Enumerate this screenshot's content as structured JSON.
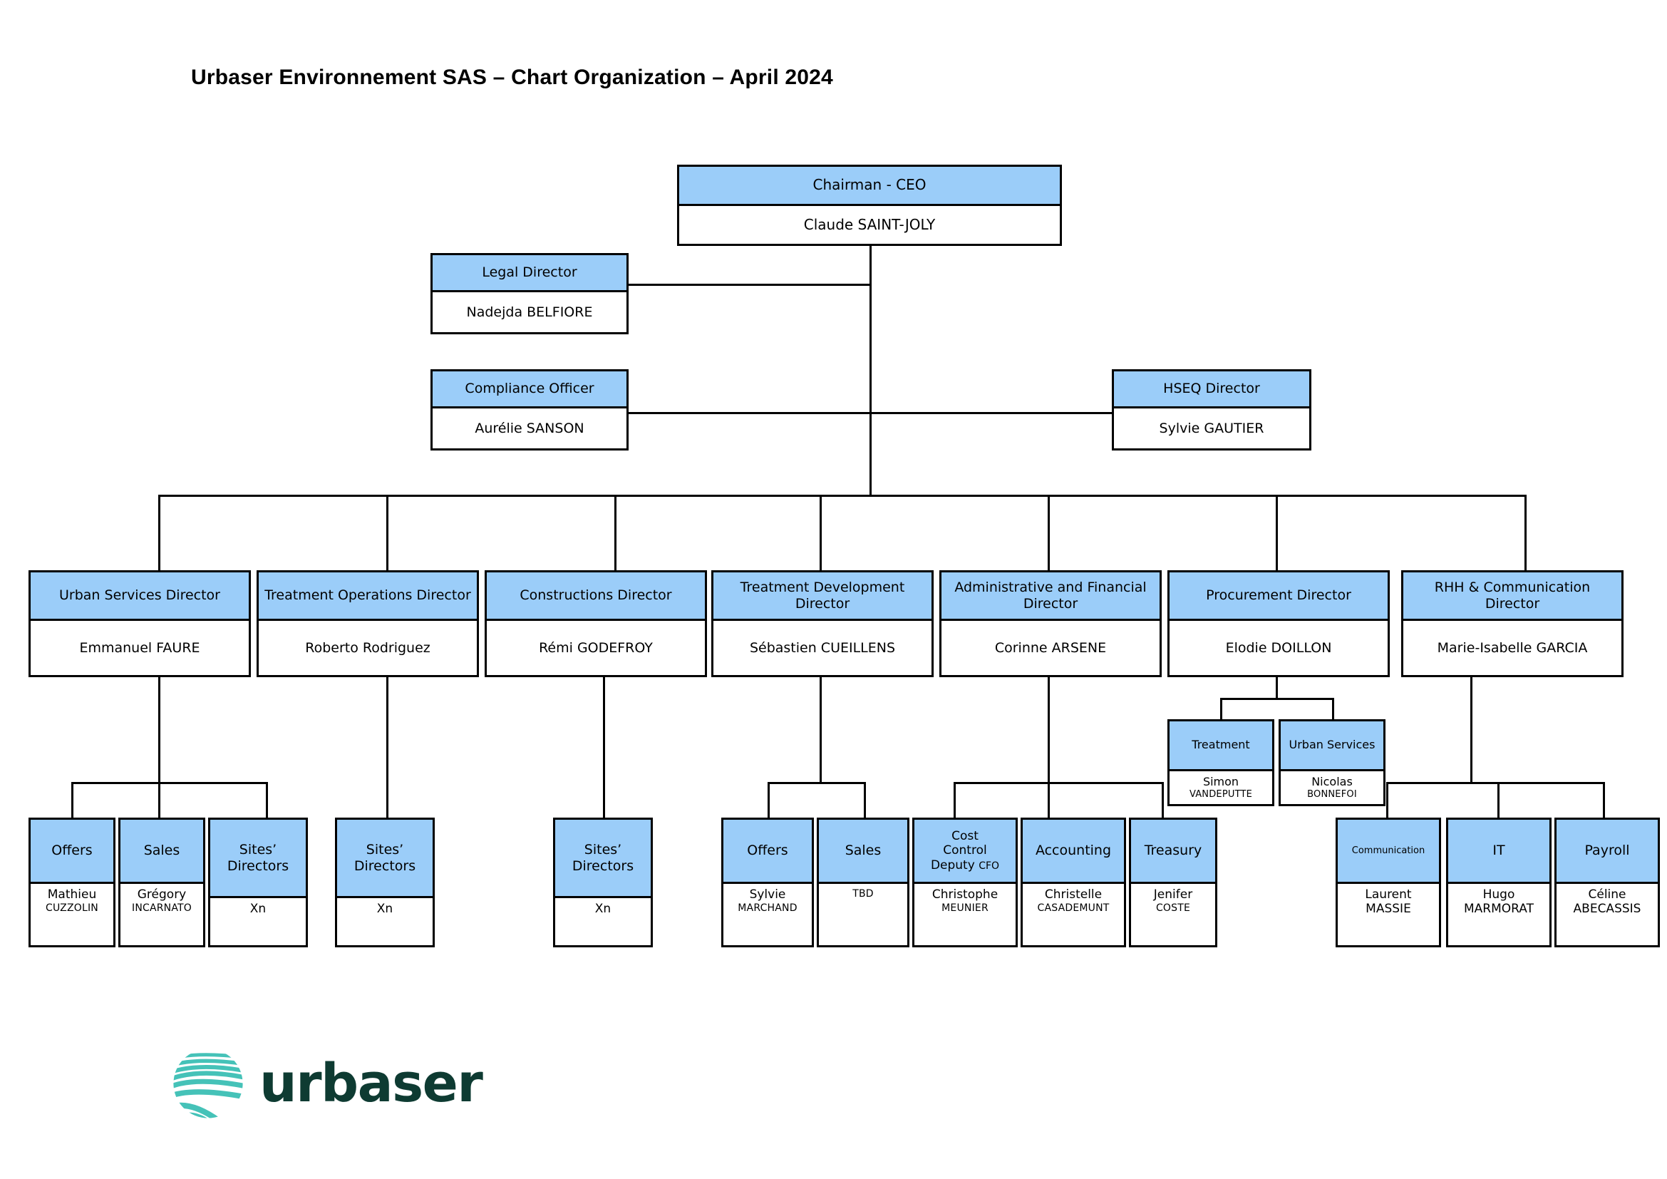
{
  "title": "Urbaser Environnement SAS – Chart Organization – April 2024",
  "logo": {
    "word": "urbaser",
    "globe_color": "#45C2B8",
    "text_color": "#0E3B32"
  },
  "colors": {
    "header_blue": "#9BCDF9",
    "line": "#000000",
    "box_bg": "#FFFFFF"
  },
  "nodes": {
    "ceo": {
      "role": "Chairman - CEO",
      "name": "Claude SAINT-JOLY"
    },
    "legal": {
      "role": "Legal Director",
      "name": "Nadejda BELFIORE"
    },
    "compliance": {
      "role": "Compliance Officer",
      "name": "Aurélie SANSON"
    },
    "hseq": {
      "role": "HSEQ Director",
      "name": "Sylvie GAUTIER"
    },
    "urban": {
      "role": "Urban Services Director",
      "name": "Emmanuel FAURE"
    },
    "treatops": {
      "role": "Treatment Operations Director",
      "name": "Roberto Rodriguez"
    },
    "construct": {
      "role": "Constructions Director",
      "name": "Rémi GODEFROY"
    },
    "treatdev": {
      "role": "Treatment Development Director",
      "name": "Sébastien CUEILLENS"
    },
    "admfin": {
      "role": "Administrative and Financial Director",
      "name": "Corinne ARSENE"
    },
    "procure": {
      "role": "Procurement Director",
      "name": "Elodie DOILLON"
    },
    "rhh": {
      "role": "RHH & Communication Director",
      "name": "Marie-Isabelle GARCIA"
    },
    "proc_treatment": {
      "role": "Treatment",
      "first": "Simon",
      "last": "VANDEPUTTE"
    },
    "proc_urban": {
      "role": "Urban Services",
      "first": "Nicolas",
      "last": "BONNEFOI"
    },
    "urb_offers": {
      "role": "Offers",
      "first": "Mathieu",
      "last": "CUZZOLIN"
    },
    "urb_sales": {
      "role": "Sales",
      "first": "Grégory",
      "last": "INCARNATO"
    },
    "urb_sites": {
      "role_line1": "Sites’",
      "role_line2": "Directors",
      "first": "Xn"
    },
    "treat_sites": {
      "role_line1": "Sites’",
      "role_line2": "Directors",
      "first": "Xn"
    },
    "const_sites": {
      "role_line1": "Sites’",
      "role_line2": "Directors",
      "first": "Xn"
    },
    "td_offers": {
      "role": "Offers",
      "first": "Sylvie",
      "last": "MARCHAND"
    },
    "td_sales": {
      "role": "Sales",
      "first": "TBD"
    },
    "cost_control": {
      "role_line1": "Cost",
      "role_line2": "Control",
      "role_line3": "Deputy",
      "role_sup": "CFO",
      "first": "Christophe",
      "last": "MEUNIER"
    },
    "accounting": {
      "role": "Accounting",
      "first": "Christelle",
      "last": "CASADEMUNT"
    },
    "treasury": {
      "role": "Treasury",
      "first": "Jenifer",
      "last": "COSTE"
    },
    "communication": {
      "role": "Communication",
      "first": "Laurent",
      "last": "MASSIE"
    },
    "it": {
      "role": "IT",
      "first": "Hugo",
      "last": "MARMORAT"
    },
    "payroll": {
      "role": "Payroll",
      "first": "Céline",
      "last": "ABECASSIS"
    }
  }
}
